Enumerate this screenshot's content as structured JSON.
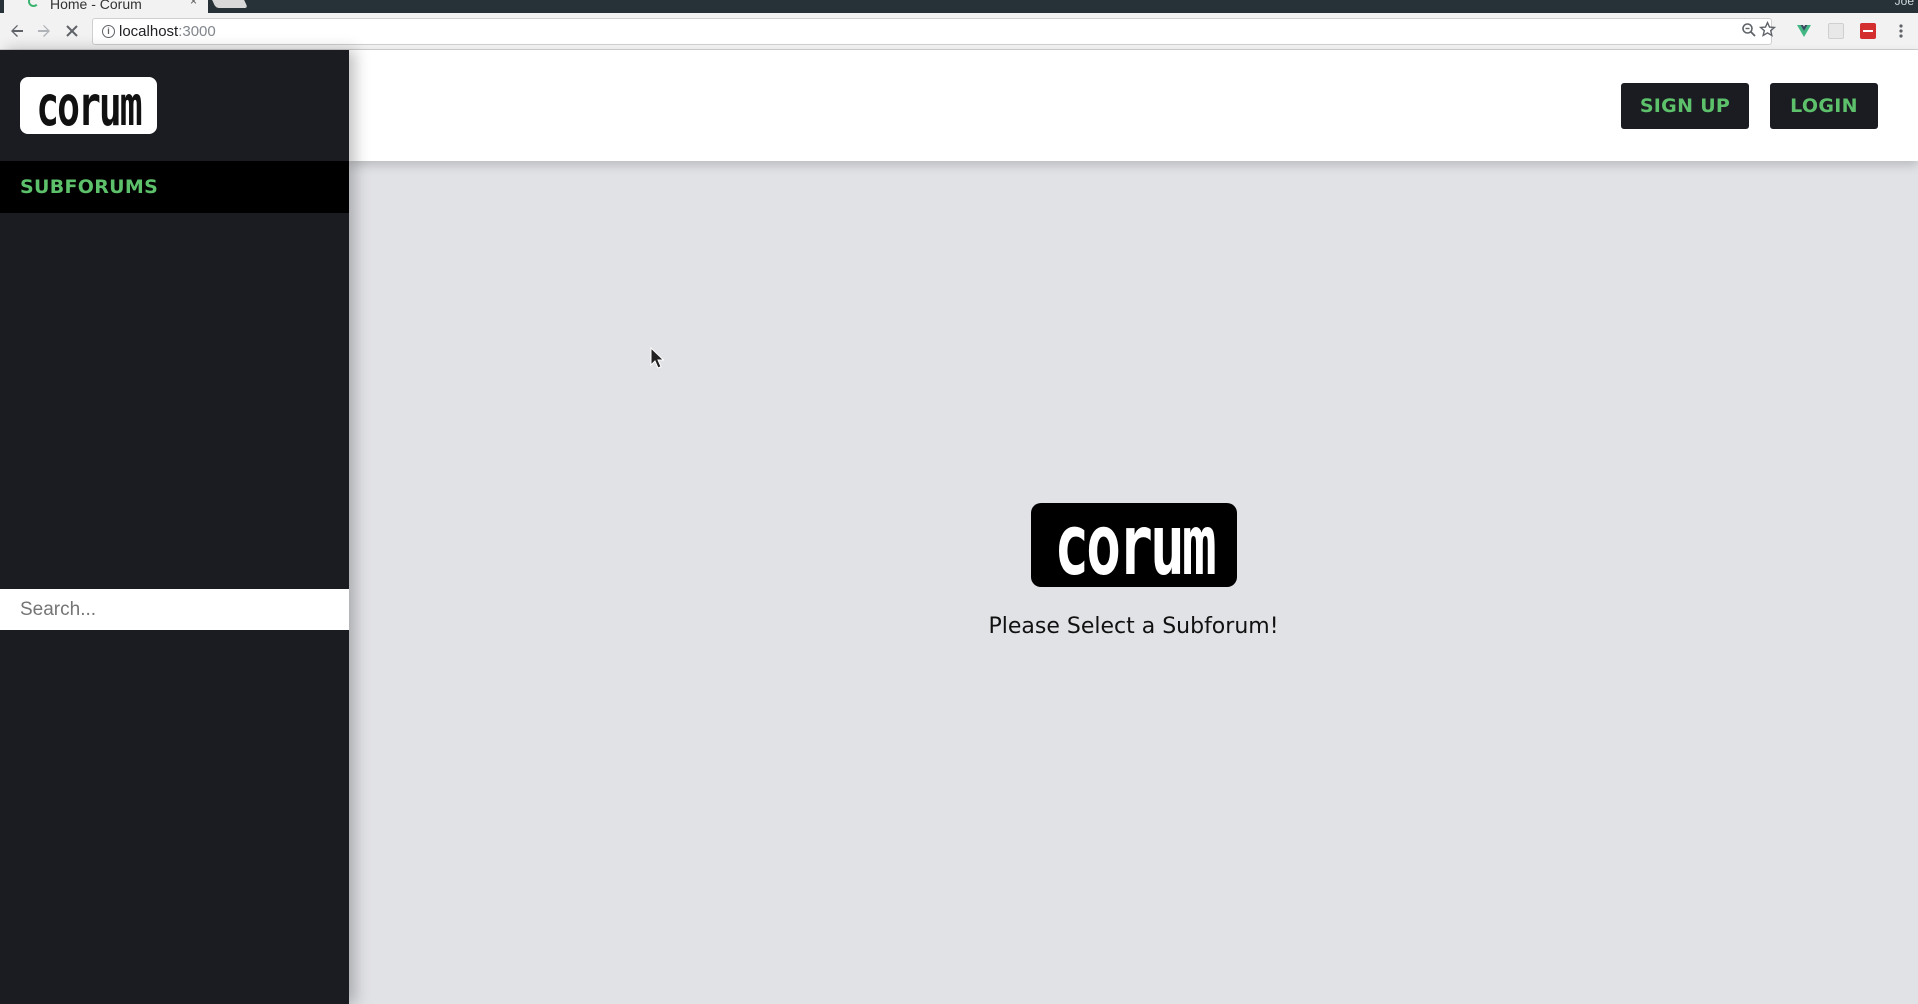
{
  "browser": {
    "tab_title": "Home - Corum",
    "tab_close": "×",
    "profile_name": "Joe",
    "url_host": "localhost",
    "url_port": ":3000"
  },
  "sidebar": {
    "logo": "corum",
    "nav_label": "SUBFORUMS",
    "search_placeholder": "Search..."
  },
  "header": {
    "signup_label": "SIGN UP",
    "login_label": "LOGIN"
  },
  "main": {
    "logo": "corum",
    "prompt": "Please Select a Subforum!"
  },
  "colors": {
    "sidebar_bg": "#1b1c22",
    "accent_green": "#5cc16a",
    "main_bg": "#e1e2e6"
  }
}
